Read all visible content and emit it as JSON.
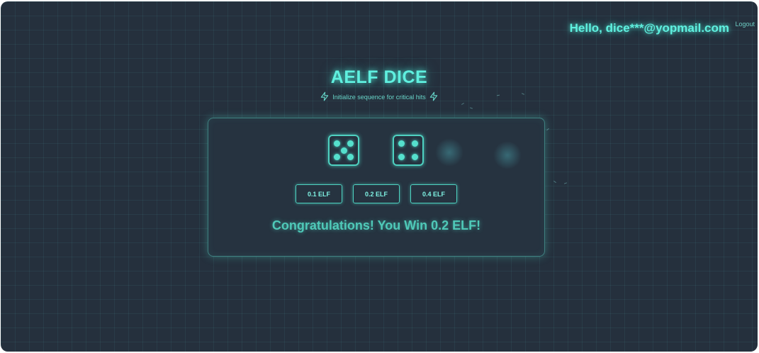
{
  "header": {
    "greeting": "Hello, dice***@yopmail.com",
    "logout_label": "Logout"
  },
  "game": {
    "title": "AELF DICE",
    "subtitle": "Initialize sequence for critical hits",
    "dice": [
      5,
      4
    ],
    "bets": [
      {
        "label": "0.1 ELF"
      },
      {
        "label": "0.2 ELF"
      },
      {
        "label": "0.4 ELF"
      }
    ],
    "result_message": "Congratulations! You Win 0.2 ELF!"
  },
  "colors": {
    "background": "#25303d",
    "accent": "#5ff0df",
    "card": "#263340"
  },
  "icons": {
    "subtitle_left": "lightning-icon",
    "subtitle_right": "lightning-icon"
  }
}
